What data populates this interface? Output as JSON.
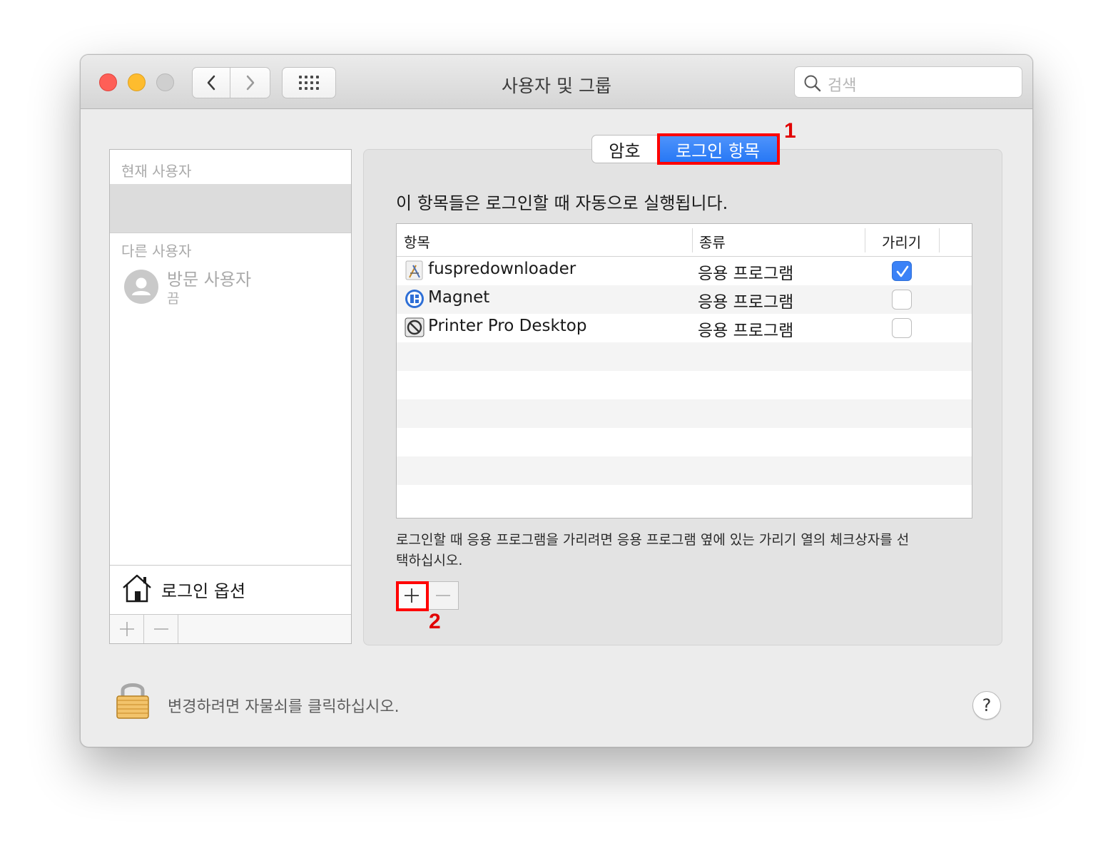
{
  "window": {
    "title": "사용자 및 그룹",
    "search_placeholder": "검색"
  },
  "sidebar": {
    "current_user_label": "현재 사용자",
    "other_users_label": "다른 사용자",
    "guest_name": "방문 사용자",
    "guest_status": "끔",
    "login_options_label": "로그인 옵션"
  },
  "tabs": [
    {
      "label": "암호",
      "selected": false
    },
    {
      "label": "로그인 항목",
      "selected": true
    }
  ],
  "intro_text": "이 항목들은 로그인할 때 자동으로 실행됩니다.",
  "table": {
    "headers": [
      "항목",
      "종류",
      "가리기"
    ],
    "rows": [
      {
        "name": "fuspredownloader",
        "kind": "응용 프로그램",
        "hide": true,
        "icon": "app-installer-icon"
      },
      {
        "name": "Magnet",
        "kind": "응용 프로그램",
        "hide": false,
        "icon": "magnet-app-icon"
      },
      {
        "name": "Printer Pro Desktop",
        "kind": "응용 프로그램",
        "hide": false,
        "icon": "blocked-app-icon"
      }
    ]
  },
  "hint": {
    "line1": "로그인할 때 응용 프로그램을 가리려면 응용 프로그램 옆에 있는 가리기 열의 체크상자를 선",
    "line2": "택하십시오."
  },
  "annotations": {
    "marker1": "1",
    "marker2": "2",
    "color": "#ff0000"
  },
  "footer": {
    "lock_text": "변경하려면 자물쇠를 클릭하십시오.",
    "help_label": "?"
  },
  "colors": {
    "accent": "#2677f5",
    "close": "#fe5f57",
    "minimize": "#febc2e"
  }
}
